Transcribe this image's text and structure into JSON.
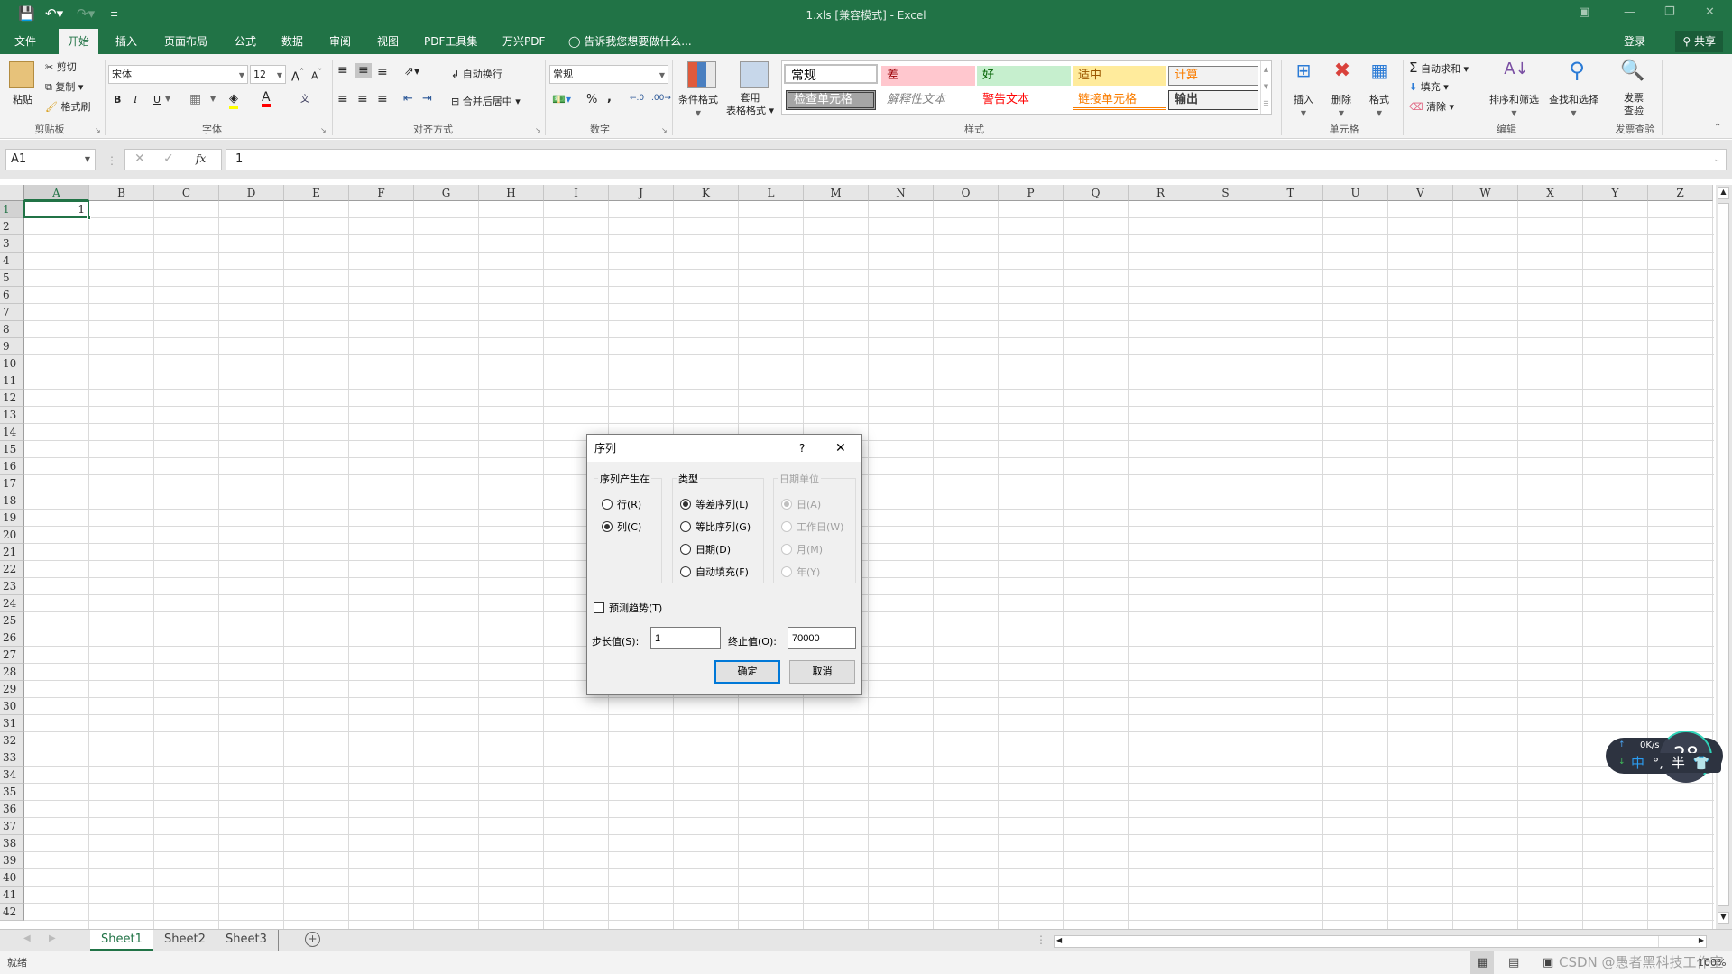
{
  "app": {
    "title": "1.xls  [兼容模式] - Excel",
    "login": "登录",
    "share": "共享"
  },
  "quick_access": {
    "save_icon": "save-icon",
    "undo_icon": "undo-icon",
    "redo_icon": "redo-icon",
    "customize_icon": "customize-icon"
  },
  "tabs": [
    {
      "label": "文件",
      "active": false
    },
    {
      "label": "开始",
      "active": true
    },
    {
      "label": "插入",
      "active": false
    },
    {
      "label": "页面布局",
      "active": false
    },
    {
      "label": "公式",
      "active": false
    },
    {
      "label": "数据",
      "active": false
    },
    {
      "label": "审阅",
      "active": false
    },
    {
      "label": "视图",
      "active": false
    },
    {
      "label": "PDF工具集",
      "active": false
    },
    {
      "label": "万兴PDF",
      "active": false
    }
  ],
  "tellme": "告诉我您想要做什么...",
  "ribbon": {
    "clipboard": {
      "label": "剪贴板",
      "paste": "粘贴",
      "cut": "剪切",
      "copy": "复制",
      "format_painter": "格式刷"
    },
    "font": {
      "label": "字体",
      "font_name": "宋体",
      "font_size": "12",
      "bold": "B",
      "italic": "I",
      "underline": "U",
      "grow": "A",
      "shrink": "A",
      "fill_color": "#ffff00",
      "font_color": "#ff0000"
    },
    "alignment": {
      "label": "对齐方式",
      "wrap_text": "自动换行",
      "merge_center": "合并后居中"
    },
    "number": {
      "label": "数字",
      "format": "常规",
      "percent": "%",
      "comma": ","
    },
    "styles": {
      "label": "样式",
      "conditional_formatting": "条件格式",
      "format_as_table_1": "套用",
      "format_as_table_2": "表格格式",
      "gallery": [
        {
          "label": "常规",
          "bg": "#ffffff",
          "color": "#000000"
        },
        {
          "label": "差",
          "bg": "#ffc7ce",
          "color": "#9c0006"
        },
        {
          "label": "好",
          "bg": "#c6efce",
          "color": "#006100"
        },
        {
          "label": "适中",
          "bg": "#ffeb9c",
          "color": "#9c5700"
        },
        {
          "label": "计算",
          "bg": "#f2f2f2",
          "color": "#fa7d00"
        },
        {
          "label": "检查单元格",
          "bg": "#a5a5a5",
          "color": "#ffffff"
        },
        {
          "label": "解释性文本",
          "bg": "#ffffff",
          "color": "#7f7f7f"
        },
        {
          "label": "警告文本",
          "bg": "#ffffff",
          "color": "#ff0000"
        },
        {
          "label": "链接单元格",
          "bg": "#ffffff",
          "color": "#fa7d00"
        },
        {
          "label": "输出",
          "bg": "#f2f2f2",
          "color": "#3f3f3f"
        }
      ]
    },
    "cells": {
      "label": "单元格",
      "insert": "插入",
      "delete": "删除",
      "format": "格式"
    },
    "editing": {
      "label": "编辑",
      "autosum": "自动求和",
      "fill": "填充",
      "clear": "清除",
      "sort_filter": "排序和筛选",
      "find_select": "查找和选择"
    },
    "invoice": {
      "label": "发票查验",
      "button_1": "发票",
      "button_2": "查验"
    }
  },
  "formula_bar": {
    "name_box": "A1",
    "value": "1",
    "fx": "fx"
  },
  "sheet": {
    "columns": [
      "A",
      "B",
      "C",
      "D",
      "E",
      "F",
      "G",
      "H",
      "I",
      "J",
      "K",
      "L",
      "M",
      "N",
      "O",
      "P",
      "Q",
      "R",
      "S",
      "T",
      "U",
      "V",
      "W",
      "X",
      "Y",
      "Z"
    ],
    "rows": [
      "1",
      "2",
      "3",
      "4",
      "5",
      "6",
      "7",
      "8",
      "9",
      "10",
      "11",
      "12",
      "13",
      "14",
      "15",
      "16",
      "17",
      "18",
      "19",
      "20",
      "21",
      "22",
      "23",
      "24",
      "25",
      "26",
      "27",
      "28",
      "29",
      "30",
      "31",
      "32",
      "33",
      "34",
      "35",
      "36",
      "37",
      "38",
      "39",
      "40",
      "41",
      "42"
    ],
    "selected_cell": "A1",
    "cells": {
      "A1": "1"
    }
  },
  "sheet_tabs": [
    {
      "label": "Sheet1",
      "active": true
    },
    {
      "label": "Sheet2",
      "active": false
    },
    {
      "label": "Sheet3",
      "active": false
    }
  ],
  "status": {
    "text": "就绪",
    "zoom": "100%",
    "watermark": "CSDN @愚者黑科技工作室"
  },
  "dialog": {
    "title": "序列",
    "help": "?",
    "series_in": {
      "legend": "序列产生在",
      "options": [
        {
          "label": "行(R)",
          "checked": false
        },
        {
          "label": "列(C)",
          "checked": true
        }
      ]
    },
    "type": {
      "legend": "类型",
      "options": [
        {
          "label": "等差序列(L)",
          "checked": true
        },
        {
          "label": "等比序列(G)",
          "checked": false
        },
        {
          "label": "日期(D)",
          "checked": false
        },
        {
          "label": "自动填充(F)",
          "checked": false
        }
      ]
    },
    "date_unit": {
      "legend": "日期单位",
      "disabled": true,
      "options": [
        {
          "label": "日(A)",
          "checked": true
        },
        {
          "label": "工作日(W)",
          "checked": false
        },
        {
          "label": "月(M)",
          "checked": false
        },
        {
          "label": "年(Y)",
          "checked": false
        }
      ]
    },
    "trend": {
      "label": "预测趋势(T)",
      "checked": false
    },
    "step_label": "步长值(S):",
    "step_value": "1",
    "stop_label": "终止值(O):",
    "stop_value": "70000",
    "ok": "确定",
    "cancel": "取消"
  },
  "ime_widget": {
    "speed": "0K/s",
    "mode": "中",
    "punct": "°,",
    "width": "半",
    "number": "28"
  }
}
